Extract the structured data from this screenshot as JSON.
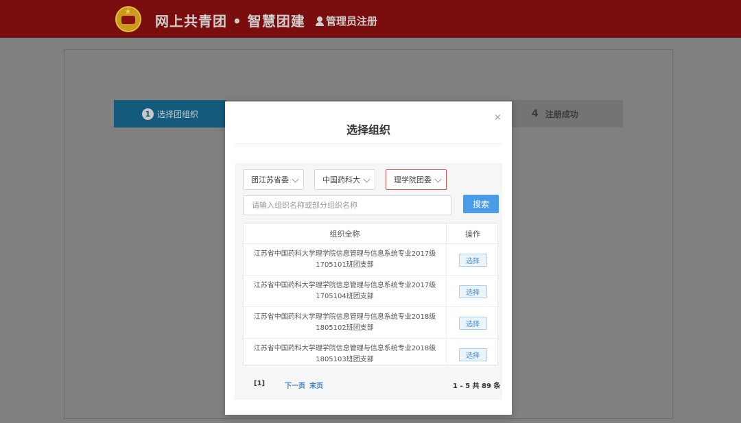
{
  "header": {
    "site_title": "网上共青团 • 智慧团建",
    "admin_register": "管理员注册"
  },
  "steps": {
    "step1_num": "1",
    "step1_label": "选择团组织",
    "step4_num": "4",
    "step4_label": "注册成功"
  },
  "modal": {
    "title": "选择组织",
    "close": "×",
    "selects": [
      {
        "value": "团江苏省委"
      },
      {
        "value": "中国药科大学"
      },
      {
        "value": "理学院团委"
      }
    ],
    "search_placeholder": "请输入组织名称或部分组织名称",
    "search_button": "搜索",
    "table": {
      "headers": {
        "name": "组织全称",
        "operation": "操作"
      },
      "rows": [
        {
          "name": "江苏省中国药科大学理学院信息管理与信息系统专业2017级1705101班团支部",
          "action": "选择"
        },
        {
          "name": "江苏省中国药科大学理学院信息管理与信息系统专业2017级1705104班团支部",
          "action": "选择"
        },
        {
          "name": "江苏省中国药科大学理学院信息管理与信息系统专业2018级1805102班团支部",
          "action": "选择"
        },
        {
          "name": "江苏省中国药科大学理学院信息管理与信息系统专业2018级1805103班团支部",
          "action": "选择"
        }
      ]
    },
    "pagination": {
      "current": "[1]",
      "next": "下一页",
      "last": "末页",
      "info": "1 - 5  共 89 条"
    }
  },
  "colors": {
    "header_bg": "#7a0d0d",
    "primary_blue": "#4b9ce8",
    "active_border": "#d9534f",
    "step_active": "#135a7c"
  }
}
